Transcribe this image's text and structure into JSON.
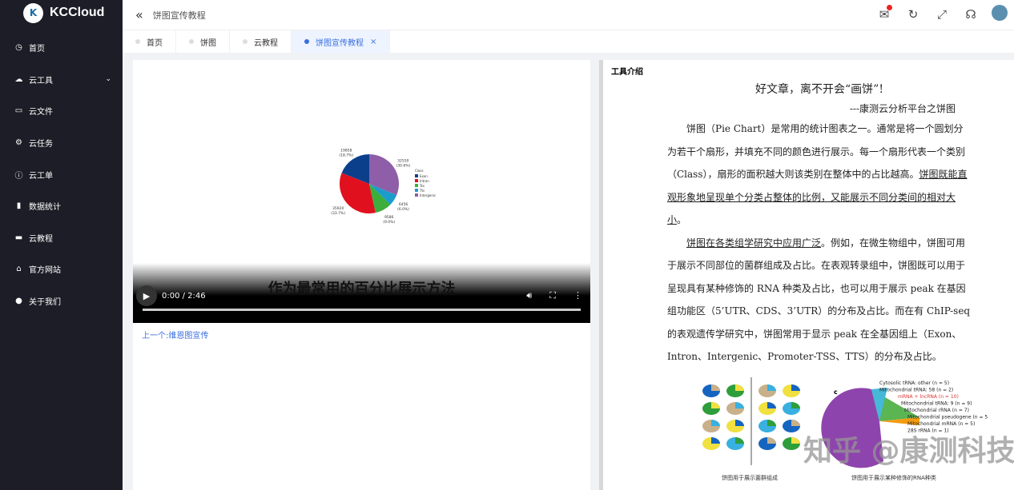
{
  "app": {
    "name": "KCCloud",
    "logo_glyph": "K"
  },
  "sidebar": {
    "items": [
      {
        "label": "首页",
        "icon": "dashboard-icon",
        "glyph": "◷"
      },
      {
        "label": "云工具",
        "icon": "cloud-icon",
        "glyph": "☁",
        "chevron": "⌄"
      },
      {
        "label": "云文件",
        "icon": "folder-icon",
        "glyph": "▭"
      },
      {
        "label": "云任务",
        "icon": "gear-icon",
        "glyph": "⚙"
      },
      {
        "label": "云工单",
        "icon": "info-icon",
        "glyph": "ⓘ"
      },
      {
        "label": "数据统计",
        "icon": "bar-chart-icon",
        "glyph": "▮"
      },
      {
        "label": "云教程",
        "icon": "truck-icon",
        "glyph": "▬"
      },
      {
        "label": "官方网站",
        "icon": "home-icon",
        "glyph": "⌂"
      },
      {
        "label": "关于我们",
        "icon": "about-icon",
        "glyph": "●"
      }
    ]
  },
  "header": {
    "breadcrumb": "饼图宣传教程",
    "back_glyph": "«"
  },
  "tabs": [
    {
      "label": "首页"
    },
    {
      "label": "饼图"
    },
    {
      "label": "云教程"
    },
    {
      "label": "饼图宣传教程",
      "close": "×"
    }
  ],
  "video": {
    "caption": "作为最常用的百分比展示方法",
    "time": "0:00 / 2:46",
    "progress": 0
  },
  "prev_link": "上一个:维恩图宣传",
  "chart_data": {
    "type": "pie",
    "categories": [
      "Exon",
      "Intron",
      "Tss",
      "Tts",
      "Intergenic"
    ],
    "values": [
      19858,
      35920,
      9586,
      6456,
      32550
    ],
    "labels": [
      "19858\n(18.7%)",
      "35920\n(33.7%)",
      "9586\n(9.0%)",
      "6456\n(6.0%)",
      "32550\n(30.6%)"
    ],
    "colors": [
      "#0b3f8c",
      "#e0101e",
      "#3cae3c",
      "#1c9ccb",
      "#8e5ea8"
    ],
    "legend_title": "Class",
    "legend": "right"
  },
  "article": {
    "panel_title": "工具介绍",
    "title": "好文章，离不开会“画饼”!",
    "subtitle": "---康测云分析平台之饼图",
    "p1a": "饼图（Pie Chart）是常用的统计图表之一。通常是将一个圆划分为若干个扇形，并填充不同的颜色进行展示。每一个扇形代表一个类别（Class），扇形的面积越大则该类别在整体中的占比越高。",
    "p1b": "饼图既能直观形象地呈现单个分类占整体的比例，又能展示不同分类间的相对大小",
    "p1c": "。",
    "p2a": "饼图在各类组学研究中应用广泛",
    "p2b": "。例如，在微生物组中，饼图可用于展示不同部位的菌群组成及占比。在表观转录组中，饼图既可以用于呈现具有某种修饰的 RNA 种类及占比，也可以用于展示 peak 在基因组功能区（5’UTR、CDS、3’UTR）的分布及占比。而在有 ChIP-seq 的表观遗传学研究中，饼图常用于显示 peak 在全基因组上（Exon、Intron、Intergenic、Promoter-TSS、TTS）的分布及占比。",
    "fig1_caption": "饼图用于展示菌群组成",
    "fig2_caption": "饼图用于展示某种修饰的RNA种类",
    "fig2_labels": [
      "Cytosolic tRNA: other (n = 5)",
      "Mitochondrial tRNA: 58 (n = 2)",
      "mRNA + lncRNA (n = 10)",
      "Mitochondrial tRNA: 9 (n = 9)",
      "Mitochondrial rRNA (n = 7)",
      "Mitochondrial pseudogene (n = 5)",
      "Mitochondrial mRNA (n = 5)",
      "28S rRNA (n = 1)"
    ],
    "watermark": "知乎 @康测科技"
  }
}
